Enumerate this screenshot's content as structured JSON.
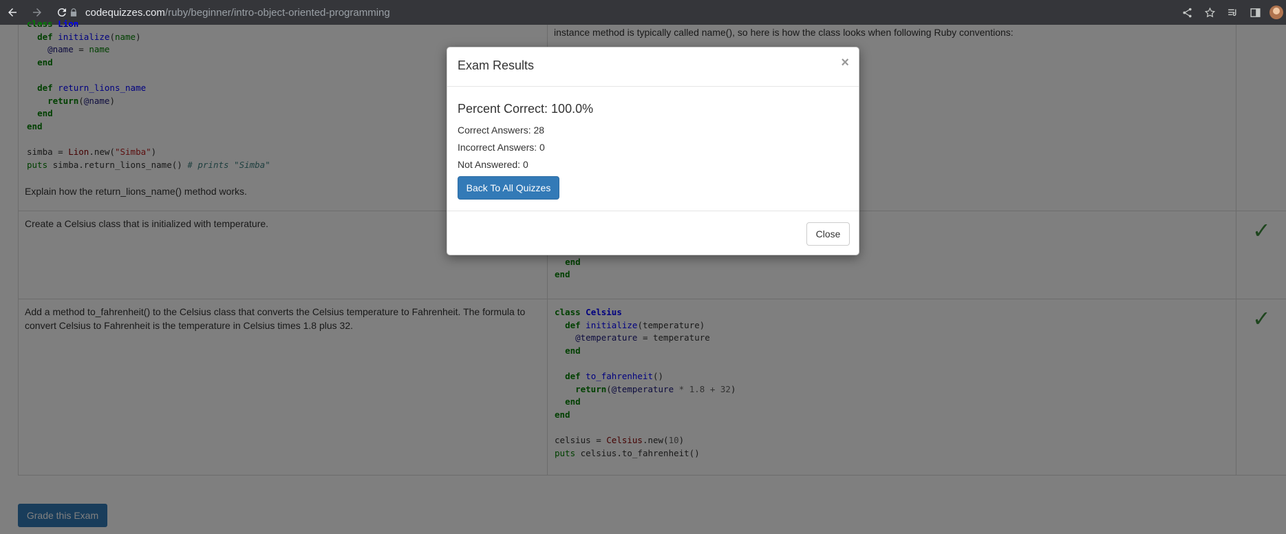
{
  "browser": {
    "url_host": "codequizzes.com",
    "url_path": "/ruby/beginner/intro-object-oriented-programming"
  },
  "page": {
    "rows": [
      {
        "question": "Explain how the return_lions_name() method works.",
        "answer_text": "instance method is typically called name(), so here is how the class looks when following Ruby conventions:"
      },
      {
        "question": "Create a Celsius class that is initialized with temperature."
      },
      {
        "question": "Add a method to_fahrenheit() to the Celsius class that converts the Celsius temperature to Fahrenheit. The formula to convert Celsius to Fahrenheit is the temperature in Celsius times 1.8 plus 32."
      }
    ],
    "check_mark": "✓",
    "grade_button": "Grade this Exam"
  },
  "modal": {
    "title": "Exam Results",
    "close_x": "×",
    "percent_correct": "Percent Correct: 100.0%",
    "correct_answers": "Correct Answers: 28",
    "incorrect_answers": "Incorrect Answers: 0",
    "not_answered": "Not Answered: 0",
    "back_button": "Back To All Quizzes",
    "close_button": "Close"
  },
  "colors": {
    "primary": "#337ab7",
    "check": "#3c8b3c"
  }
}
